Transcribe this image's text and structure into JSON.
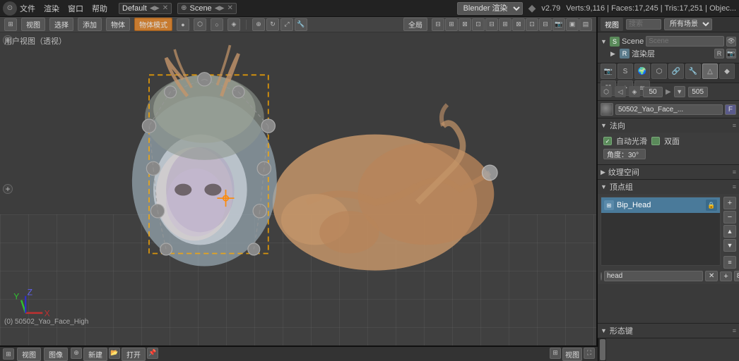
{
  "topbar": {
    "info_icon": "ℹ",
    "menu_items": [
      "文件",
      "渲染",
      "窗口",
      "帮助"
    ],
    "workspace": "Default",
    "scene_label": "Scene",
    "engine": "Blender 渲染",
    "version": "v2.79",
    "stats": "Verts:9,116 | Faces:17,245 | Tris:17,251 | Objec..."
  },
  "viewport": {
    "user_label": "用户视图（透视）",
    "status": "(0) 50502_Yao_Face_High",
    "tabs": [
      "视图",
      "选择",
      "添加",
      "物体"
    ],
    "mode": "物体模式",
    "shade": "●",
    "global": "全局",
    "bottomtabs": [
      "视图",
      "图像"
    ]
  },
  "right_panel": {
    "tabs": [
      "视图",
      "搜索",
      "所有场景"
    ],
    "scene_name": "Scene",
    "layer_input": "渲染层",
    "material_name": "50502_Yao_Face_...",
    "material_f": "F",
    "num1": "50",
    "num2": "505",
    "sections": {
      "normal": "法向",
      "auto_smooth": "自动光滑",
      "two_sided": "双面",
      "angle_label": "角度：30°",
      "uv": "纹理空间",
      "vertex_group": "顶点组",
      "shape_keys": "形态键"
    },
    "vertex_group": {
      "item_name": "Bip_Head",
      "weight_value": "head"
    }
  }
}
